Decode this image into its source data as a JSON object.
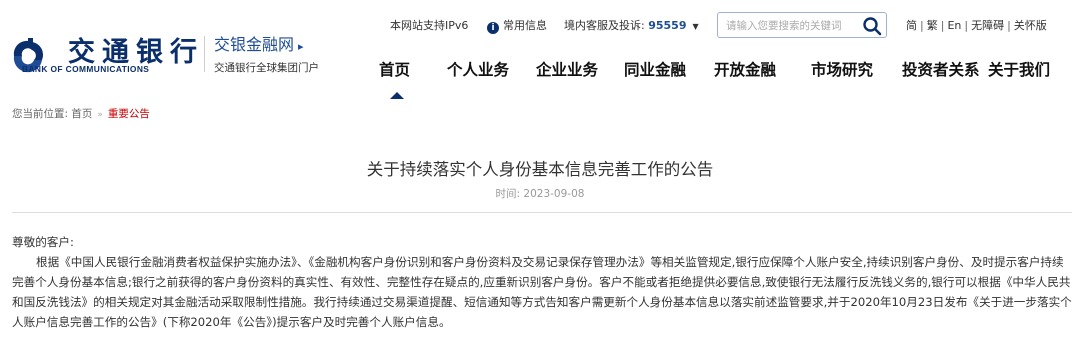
{
  "brand": {
    "logo_cn": "交通银行",
    "logo_en": "BANK OF COMMUNICATIONS",
    "subsite_title": "交银金融网",
    "subsite_arrow": "▸",
    "subsite_desc": "交通银行全球集团门户",
    "color_primary": "#0b2f6b",
    "color_accent": "#c00000"
  },
  "topbar": {
    "ipv6": "本网站支持IPv6",
    "info_icon": "info-icon",
    "common_info": "常用信息",
    "hotline_label": "境内客服及投诉:",
    "hotline_number": "95559",
    "hotline_caret": "▼",
    "search_placeholder": "请输入您要搜索的关键词",
    "lang": [
      "简",
      "繁",
      "En",
      "无障碍",
      "关怀版"
    ]
  },
  "nav": {
    "items": [
      "首页",
      "个人业务",
      "企业业务",
      "同业金融",
      "开放金融",
      "市场研究",
      "投资者关系",
      "关于我们"
    ],
    "active": "首页"
  },
  "breadcrumb": {
    "label": "您当前位置:",
    "home": "首页",
    "separator": "»",
    "current": "重要公告"
  },
  "article": {
    "title": "关于持续落实个人身份基本信息完善工作的公告",
    "date": "时间: 2023-09-08",
    "salutation": "尊敬的客户:",
    "paragraph": "根据《中国人民银行金融消费者权益保护实施办法》、《金融机构客户身份识别和客户身份资料及交易记录保存管理办法》等相关监管规定,银行应保障个人账户安全,持续识别客户身份、及时提示客户持续完善个人身份基本信息;银行之前获得的客户身份资料的真实性、有效性、完整性存在疑点的,应重新识别客户身份。客户不能或者拒绝提供必要信息,致使银行无法履行反洗钱义务的,银行可以根据《中华人民共和国反洗钱法》的相关规定对其金融活动采取限制性措施。我行持续通过交易渠道提醒、短信通知等方式告知客户需更新个人身份基本信息以落实前述监管要求,并于2020年10月23日发布《关于进一步落实个人账户信息完善工作的公告》(下称2020年《公告》)提示客户及时完善个人账户信息。"
  }
}
